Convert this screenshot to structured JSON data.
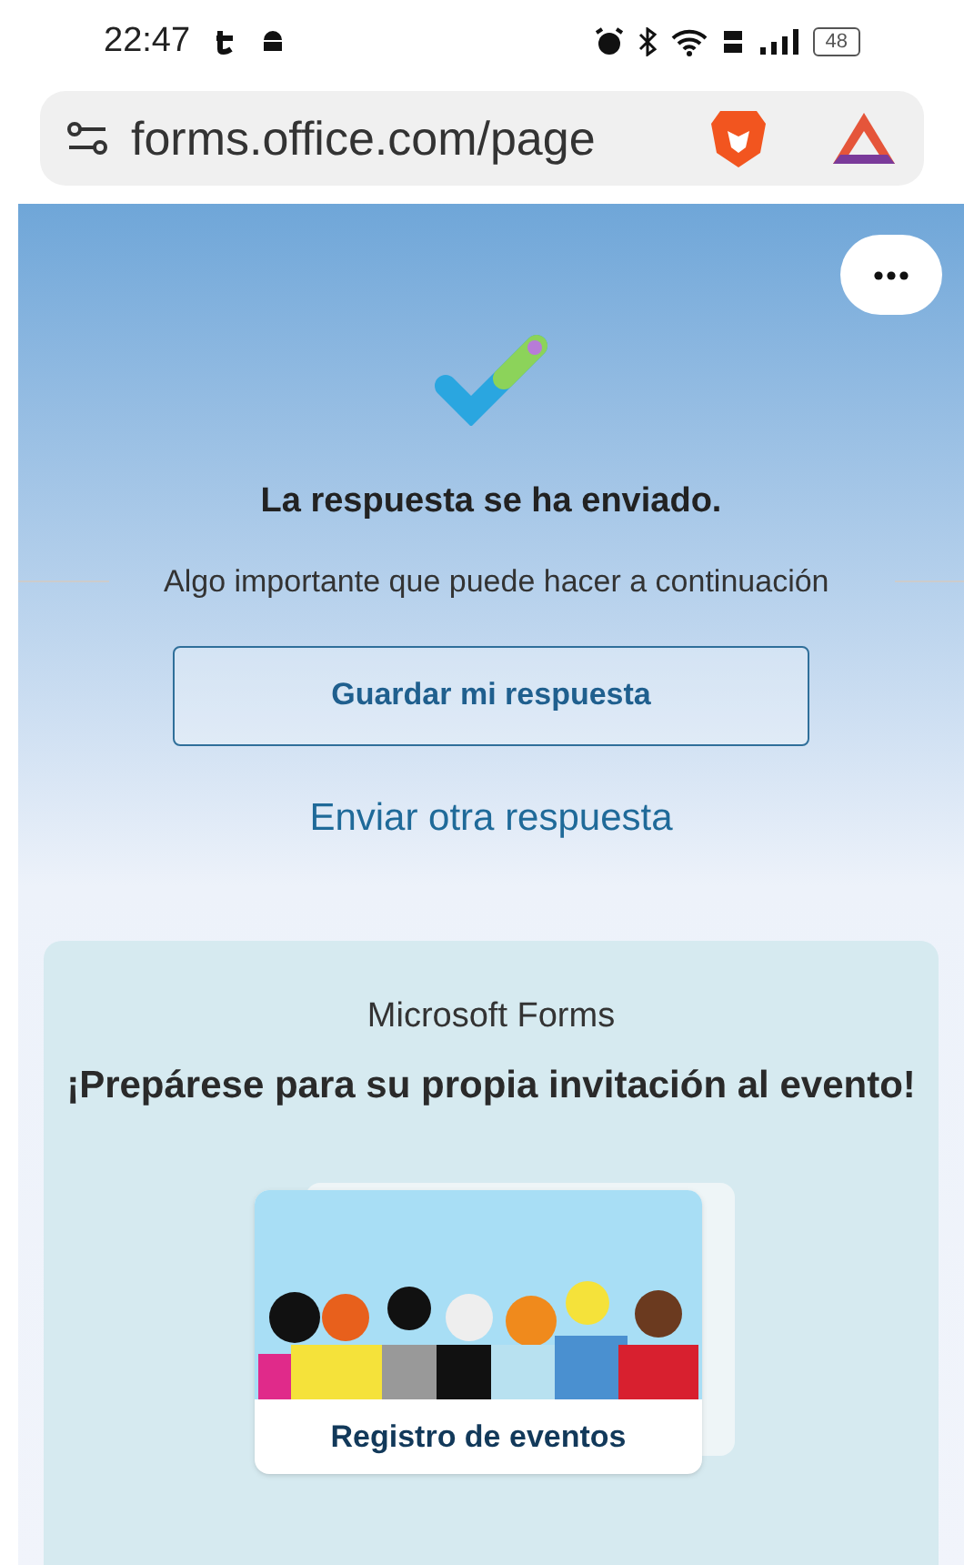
{
  "status_bar": {
    "time": "22:47",
    "battery": "48"
  },
  "browser": {
    "url": "forms.office.com/page"
  },
  "confirmation": {
    "title": "La respuesta se ha enviado.",
    "subtitle": "Algo importante que puede hacer a continuación",
    "save_button": "Guardar mi respuesta",
    "send_another_link": "Enviar otra respuesta"
  },
  "promo": {
    "brand": "Microsoft Forms",
    "heading": "¡Prepárese para su propia invitación al evento!",
    "card_title": "Registro de eventos"
  }
}
